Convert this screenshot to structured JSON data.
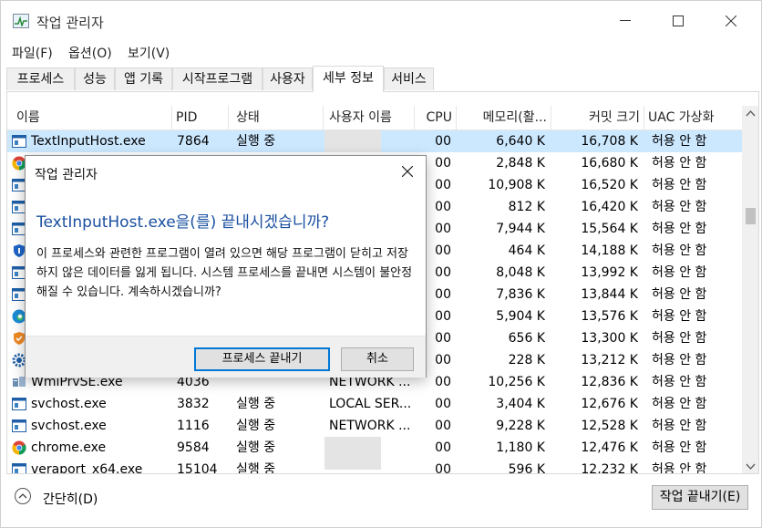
{
  "window": {
    "title": "작업 관리자"
  },
  "menu": [
    "파일(F)",
    "옵션(O)",
    "보기(V)"
  ],
  "tabs": [
    "프로세스",
    "성능",
    "앱 기록",
    "시작프로그램",
    "사용자",
    "세부 정보",
    "서비스"
  ],
  "active_tab": "세부 정보",
  "columns": [
    "이름",
    "PID",
    "상태",
    "사용자 이름",
    "CPU",
    "메모리(활...",
    "커밋 크기",
    "UAC 가상화"
  ],
  "rows": [
    {
      "name": "TextInputHost.exe",
      "pid": "7864",
      "status": "실행 중",
      "user": "",
      "cpu": "00",
      "mem": "6,640 K",
      "commit": "16,708 K",
      "uac": "허용 안 함",
      "icon": "app-window-icon"
    },
    {
      "name": "",
      "pid": "",
      "status": "",
      "user": "",
      "cpu": "00",
      "mem": "2,848 K",
      "commit": "16,680 K",
      "uac": "허용 안 함",
      "icon": "chrome-icon"
    },
    {
      "name": "",
      "pid": "",
      "status": "",
      "user": "",
      "cpu": "00",
      "mem": "10,908 K",
      "commit": "16,520 K",
      "uac": "허용 안 함",
      "icon": "app-window-icon"
    },
    {
      "name": "",
      "pid": "",
      "status": "",
      "user": "",
      "cpu": "00",
      "mem": "812 K",
      "commit": "16,420 K",
      "uac": "허용 안 함",
      "icon": "app-window-icon"
    },
    {
      "name": "",
      "pid": "",
      "status": "",
      "user": "",
      "cpu": "00",
      "mem": "7,944 K",
      "commit": "15,564 K",
      "uac": "허용 안 함",
      "icon": "app-window-icon"
    },
    {
      "name": "",
      "pid": "",
      "status": "",
      "user": "",
      "cpu": "00",
      "mem": "464 K",
      "commit": "14,188 K",
      "uac": "허용 안 함",
      "icon": "shield-icon"
    },
    {
      "name": "",
      "pid": "",
      "status": "",
      "user": "",
      "cpu": "00",
      "mem": "8,048 K",
      "commit": "13,992 K",
      "uac": "허용 안 함",
      "icon": "app-window-icon"
    },
    {
      "name": "",
      "pid": "",
      "status": "",
      "user": "",
      "cpu": "00",
      "mem": "7,836 K",
      "commit": "13,844 K",
      "uac": "허용 안 함",
      "icon": "app-window-icon"
    },
    {
      "name": "",
      "pid": "",
      "status": "",
      "user": "",
      "cpu": "00",
      "mem": "5,904 K",
      "commit": "13,576 K",
      "uac": "허용 안 함",
      "icon": "edge-icon"
    },
    {
      "name": "",
      "pid": "",
      "status": "",
      "user": "",
      "cpu": "00",
      "mem": "656 K",
      "commit": "13,300 K",
      "uac": "허용 안 함",
      "icon": "orange-shield-icon"
    },
    {
      "name": "",
      "pid": "",
      "status": "",
      "user": "",
      "cpu": "00",
      "mem": "228 K",
      "commit": "13,212 K",
      "uac": "허용 안 함",
      "icon": "gear-icon"
    },
    {
      "name": "WmiPrvSE.exe",
      "pid": "4036",
      "status": "",
      "user": "NETWORK ...",
      "cpu": "00",
      "mem": "10,256 K",
      "commit": "12,836 K",
      "uac": "허용 안 함",
      "icon": "wmi-icon"
    },
    {
      "name": "svchost.exe",
      "pid": "3832",
      "status": "실행 중",
      "user": "LOCAL SER...",
      "cpu": "00",
      "mem": "3,404 K",
      "commit": "12,676 K",
      "uac": "허용 안 함",
      "icon": "app-window-icon"
    },
    {
      "name": "svchost.exe",
      "pid": "1116",
      "status": "실행 중",
      "user": "NETWORK ...",
      "cpu": "00",
      "mem": "9,228 K",
      "commit": "12,528 K",
      "uac": "허용 안 함",
      "icon": "app-window-icon"
    },
    {
      "name": "chrome.exe",
      "pid": "9584",
      "status": "실행 중",
      "user": "",
      "cpu": "00",
      "mem": "1,180 K",
      "commit": "12,476 K",
      "uac": "허용 안 함",
      "icon": "chrome-icon"
    },
    {
      "name": "veraport_x64.exe",
      "pid": "15104",
      "status": "실행 중",
      "user": "",
      "cpu": "00",
      "mem": "596 K",
      "commit": "12,232 K",
      "uac": "허용 안 함",
      "icon": "app-window-icon"
    }
  ],
  "footer": {
    "fewer_details": "간단히(D)",
    "end_task": "작업 끝내기(E)"
  },
  "dialog": {
    "title": "작업 관리자",
    "heading": "TextInputHost.exe을(를) 끝내시겠습니까?",
    "body": "이 프로세스와 관련한 프로그램이 열려 있으면 해당 프로그램이 닫히고 저장하지 않은 데이터를 잃게 됩니다. 시스템 프로세스를 끝내면 시스템이 불안정해질 수 있습니다. 계속하시겠습니까?",
    "confirm": "프로세스 끝내기",
    "cancel": "취소"
  },
  "colors": {
    "selected_row": "#cce8ff",
    "heading": "#1a4fa0",
    "focus_border": "#0078d7"
  }
}
